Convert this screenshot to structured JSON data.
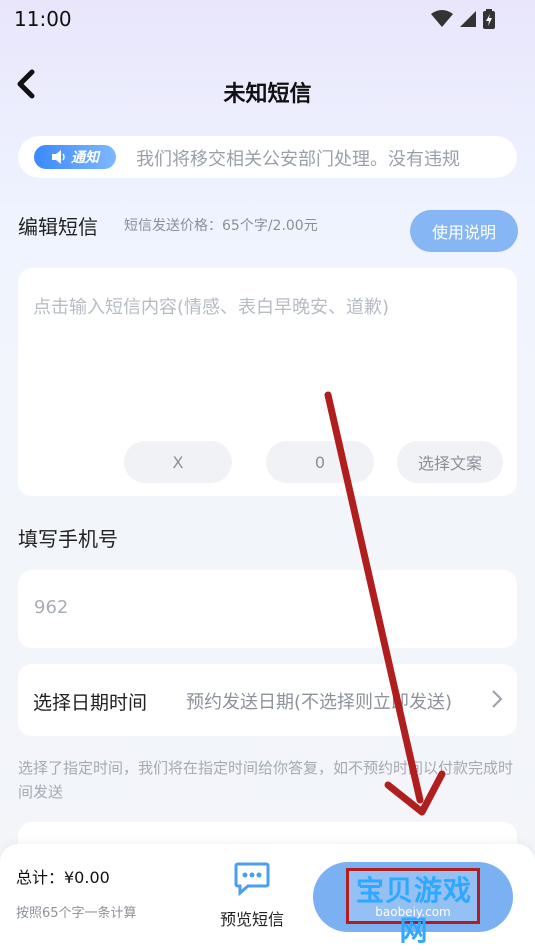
{
  "status_bar": {
    "time": "11:00"
  },
  "nav": {
    "title": "未知短信"
  },
  "notice": {
    "badge": "通知",
    "text": "我们将移交相关公安部门处理。没有违规"
  },
  "edit_section": {
    "title": "编辑短信",
    "price_note": "短信发送价格：65个字/2.00元",
    "help_button": "使用说明"
  },
  "sms_input": {
    "placeholder": "点击输入短信内容(情感、表白早晚安、道歉)",
    "pill_1": "X",
    "pill_2": "0",
    "pick_template": "选择文案"
  },
  "phone_section": {
    "title": "填写手机号",
    "value": "962"
  },
  "schedule": {
    "label": "选择日期时间",
    "value": "预约发送日期(不选择则立即发送)"
  },
  "hint": "选择了指定时间，我们将在指定时间给你答复，如不预约时间以付款完成时间发送",
  "bottom": {
    "total": "总计：¥0.00",
    "total_note": "按照65个字一条计算",
    "preview_label": "预览短信"
  },
  "watermark": {
    "text": "宝贝游戏网",
    "url": "baobeiy.com"
  },
  "colors": {
    "accent": "#87b6f4",
    "arrow": "#b01e1e"
  }
}
